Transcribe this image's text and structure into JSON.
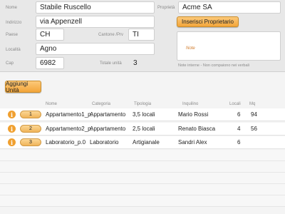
{
  "form": {
    "nome": {
      "label": "Nome",
      "value": "Stabile Ruscello"
    },
    "indirizzo": {
      "label": "Indirizzo",
      "value": "via Appenzell"
    },
    "paese": {
      "label": "Paese",
      "value": "CH"
    },
    "cantone": {
      "label": "Cantone /Prv",
      "value": "TI"
    },
    "localita": {
      "label": "Località",
      "value": "Agno"
    },
    "cap": {
      "label": "Cap",
      "value": "6982"
    },
    "totale": {
      "label": "Totale unità",
      "value": "3"
    },
    "proprieta": {
      "label": "Proprietà",
      "value": "Acme SA"
    },
    "inserisci_label": "Inserisci Proprietario",
    "note_label": "Note",
    "note_hint": "Note interne - Non compaiono nei verbali"
  },
  "aggiungi_label": "Aggiungi Unità",
  "table": {
    "headers": [
      "Nome",
      "Categoria",
      "Tipologia",
      "Inquilino",
      "Locali",
      "Mq"
    ],
    "rows": [
      {
        "num": "1",
        "nome": "Appartamento1_p.",
        "categoria": "Appartamento",
        "tipologia": "3,5 locali",
        "inquilino": "Mario Rossi",
        "locali": "6",
        "mq": "94"
      },
      {
        "num": "2",
        "nome": "Appartamento2_p.",
        "categoria": "Appartamento",
        "tipologia": "2,5 locali",
        "inquilino": "Renato Biasca",
        "locali": "4",
        "mq": "56"
      },
      {
        "num": "3",
        "nome": "Laboratorio_p.0",
        "categoria": "Laboratorio",
        "tipologia": "Artigianale",
        "inquilino": "Sandri Alex",
        "locali": "6",
        "mq": ""
      }
    ]
  },
  "colors": {
    "accent": "#f3a53a",
    "note_label": "#d07a2a"
  },
  "icons": {
    "row_info": "info-icon"
  }
}
